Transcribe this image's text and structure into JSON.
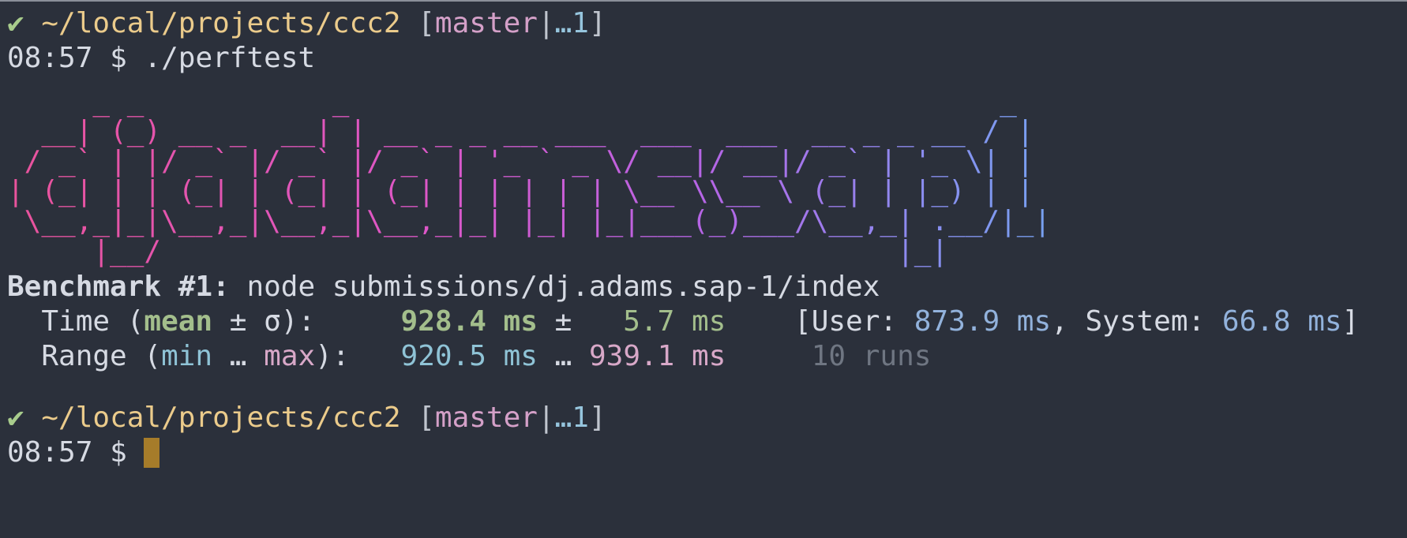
{
  "window": {
    "app": "terminal",
    "background": "#2b303b"
  },
  "prompt1": {
    "check": "✔",
    "path": "~/local/projects/ccc2",
    "open_bracket": " [",
    "branch": "master",
    "sep": "|",
    "dirty": "…1",
    "close_bracket": "]",
    "time": "08:57",
    "dollar": "$",
    "command": "./perftest"
  },
  "ascii_art": {
    "text": "     _ _           _                                      _ \n  __| (_) __ _  __| | __ _ _ __ ___  ___  ___  __ _ _ __ / |\n / _` | |/ _` |/ _` |/ _` | '_ ` _ \\/ __|/ __|/ _` | '_ \\| |\n| (_| | | (_| | (_| | (_| | | | | | \\__ \\\\__ \\ (_| | |_) | |\n \\__,_|_|\\__,_|\\__,_|\\__,_|_| |_| |_|___(_)___/\\__,_| .__/|_|\n     |__/                                           |_|    "
  },
  "benchmark": {
    "label": "Benchmark #1:",
    "command": " node submissions/dj.adams.sap-1/index",
    "time_label_prefix": "  Time (",
    "time_label_mean": "mean",
    "time_label_suffix": " ± σ):     ",
    "mean_value": "928.4 ms",
    "pm": " ±   ",
    "sigma_value": "5.7 ms",
    "user_prefix": "    [User: ",
    "user_value": "873.9 ms",
    "system_prefix": ", System: ",
    "system_value": "66.8 ms",
    "user_suffix": "]",
    "range_label_prefix": "  Range (",
    "range_min": "min",
    "range_ellipsis": " … ",
    "range_max": "max",
    "range_label_suffix": "):   ",
    "min_value": "920.5 ms",
    "range_sep": " … ",
    "max_value": "939.1 ms",
    "runs": "     10 runs"
  },
  "prompt2": {
    "check": "✔",
    "path": "~/local/projects/ccc2",
    "open_bracket": " [",
    "branch": "master",
    "sep": "|",
    "dirty": "…1",
    "close_bracket": "]",
    "time": "08:57",
    "dollar": "$"
  }
}
